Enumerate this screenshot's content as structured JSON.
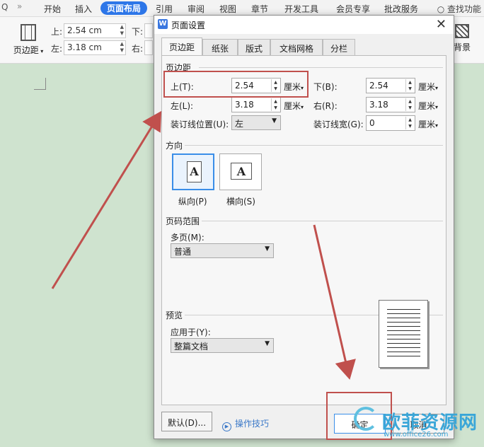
{
  "ribbon": {
    "tabs": [
      "开始",
      "插入",
      "页面布局",
      "引用",
      "审阅",
      "视图",
      "章节",
      "开发工具",
      "会员专享",
      "批改服务"
    ],
    "active_tab": "页面布局",
    "search_label": "查找功能",
    "margin_button_label": "页边距",
    "background_label": "背景",
    "top_label": "上:",
    "top_value": "2.54 cm",
    "bottom_label": "下:",
    "left_label": "左:",
    "left_value": "3.18 cm",
    "right_label": "右:"
  },
  "dialog": {
    "title": "页面设置",
    "tabs": [
      "页边距",
      "纸张",
      "版式",
      "文档网格",
      "分栏"
    ],
    "active_tab": "页边距",
    "margins_section": "页边距",
    "top_label": "上(T):",
    "top_value": "2.54",
    "bottom_label": "下(B):",
    "bottom_value": "2.54",
    "left_label": "左(L):",
    "left_value": "3.18",
    "right_label": "右(R):",
    "right_value": "3.18",
    "unit": "厘米",
    "gutter_pos_label": "装订线位置(U):",
    "gutter_pos_value": "左",
    "gutter_width_label": "装订线宽(G):",
    "gutter_width_value": "0",
    "orientation_section": "方向",
    "portrait_label": "纵向(P)",
    "landscape_label": "横向(S)",
    "orientation_selected": "portrait",
    "page_range_section": "页码范围",
    "multiple_pages_label": "多页(M):",
    "multiple_pages_value": "普通",
    "preview_section": "预览",
    "apply_to_label": "应用于(Y):",
    "apply_to_value": "整篇文档",
    "default_button": "默认(D)...",
    "tips_link": "操作技巧",
    "ok_button": "确定",
    "cancel_button": "取消"
  },
  "watermark": {
    "text": "欧菲资源网",
    "url": "www.office26.com"
  },
  "colors": {
    "accent": "#2d76e8",
    "annotation": "#c0504d",
    "document_bg": "#cfe3cf"
  }
}
